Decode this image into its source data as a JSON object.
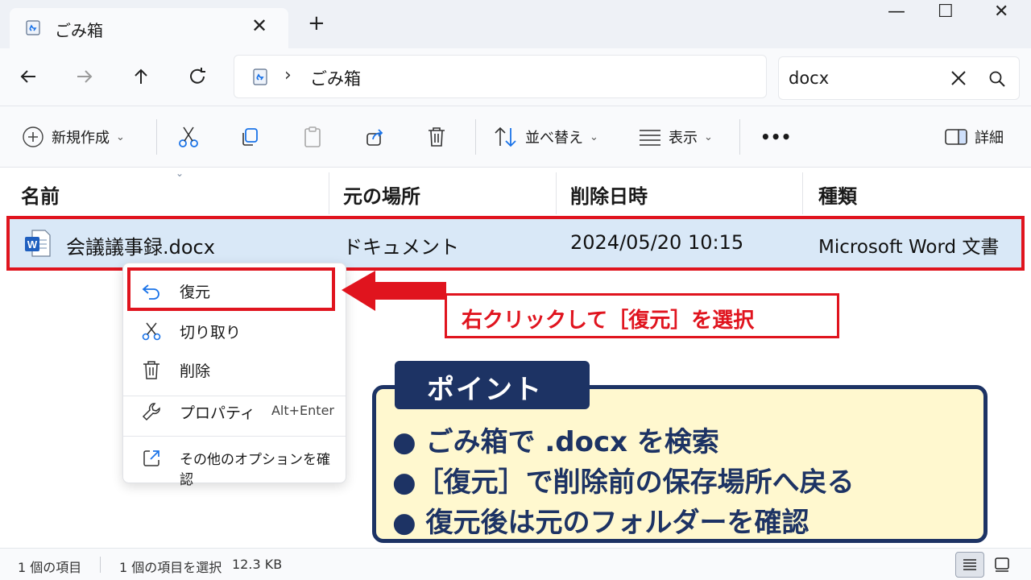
{
  "tab": {
    "title": "ごみ箱",
    "close": "✕",
    "new": "+"
  },
  "window": {
    "minimize": "—",
    "maximize": "☐",
    "close": "✕"
  },
  "address": {
    "separator": "›",
    "location": "ごみ箱"
  },
  "search": {
    "value": "docx",
    "clear": "✕"
  },
  "toolbar": {
    "new_label": "新規作成",
    "sort_label": "並べ替え",
    "view_label": "表示",
    "more_label": "•••",
    "details_label": "詳細"
  },
  "columns": {
    "name": "名前",
    "original_location": "元の場所",
    "deleted_date": "削除日時",
    "type": "種類",
    "sort_indicator": "⌄"
  },
  "file": {
    "name": "会議議事録.docx",
    "location": "ドキュメント",
    "deleted": "2024/05/20 10:15",
    "type": "Microsoft Word 文書"
  },
  "context_menu": {
    "restore": "復元",
    "cut": "切り取り",
    "delete": "削除",
    "properties": "プロパティ",
    "properties_shortcut": "Alt+Enter",
    "more_options": "その他のオプションを確認"
  },
  "callout": {
    "text": "右クリックして［復元］を選択"
  },
  "point": {
    "tag": "ポイント",
    "bullets": [
      "● ごみ箱で .docx を検索",
      "●［復元］で削除前の保存場所へ戻る",
      "● 復元後は元のフォルダーを確認"
    ]
  },
  "status": {
    "count": "1 個の項目",
    "selected": "1 個の項目を選択",
    "size": "12.3 KB"
  },
  "colors": {
    "accent_red": "#e0141e",
    "navy": "#1d3364",
    "selection": "#d9e8f7",
    "note_bg": "#fff8cf"
  }
}
